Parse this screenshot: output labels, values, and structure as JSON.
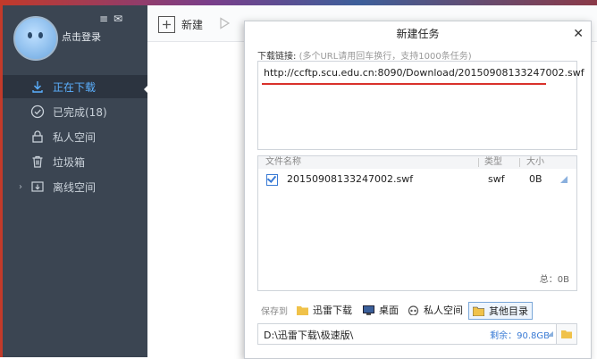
{
  "sidebar": {
    "login": "点击登录",
    "items": [
      {
        "label": "正在下载",
        "icon": "download-icon"
      },
      {
        "label": "已完成(18)",
        "icon": "check-circle-icon"
      },
      {
        "label": "私人空间",
        "icon": "lock-icon"
      },
      {
        "label": "垃圾箱",
        "icon": "trash-icon"
      },
      {
        "label": "离线空间",
        "icon": "cloud-download-icon"
      }
    ]
  },
  "toolbar": {
    "new_label": "新建"
  },
  "dialog": {
    "title": "新建任务",
    "link_label": "下载链接:",
    "link_hint": "(多个URL请用回车换行，支持1000条任务)",
    "url": "http://ccftp.scu.edu.cn:8090/Download/20150908133247002.swf",
    "columns": {
      "name": "文件名称",
      "type": "类型",
      "size": "大小"
    },
    "file": {
      "name": "20150908133247002.swf",
      "type": "swf",
      "size": "0B"
    },
    "total": "总：0B",
    "save_label": "保存到",
    "save_options": [
      {
        "label": "迅雷下载",
        "icon": "folder-icon"
      },
      {
        "label": "桌面",
        "icon": "desktop-icon"
      },
      {
        "label": "私人空间",
        "icon": "private-space-icon"
      },
      {
        "label": "其他目录",
        "icon": "folder-icon"
      }
    ],
    "path": "D:\\迅雷下载\\极速版\\",
    "remaining": "剩余：90.8GB"
  },
  "colors": {
    "accent": "#3a7bd5",
    "sidebar_bg": "#3b4552",
    "active_text": "#5bb0ff",
    "highlight": "#d9312b"
  }
}
